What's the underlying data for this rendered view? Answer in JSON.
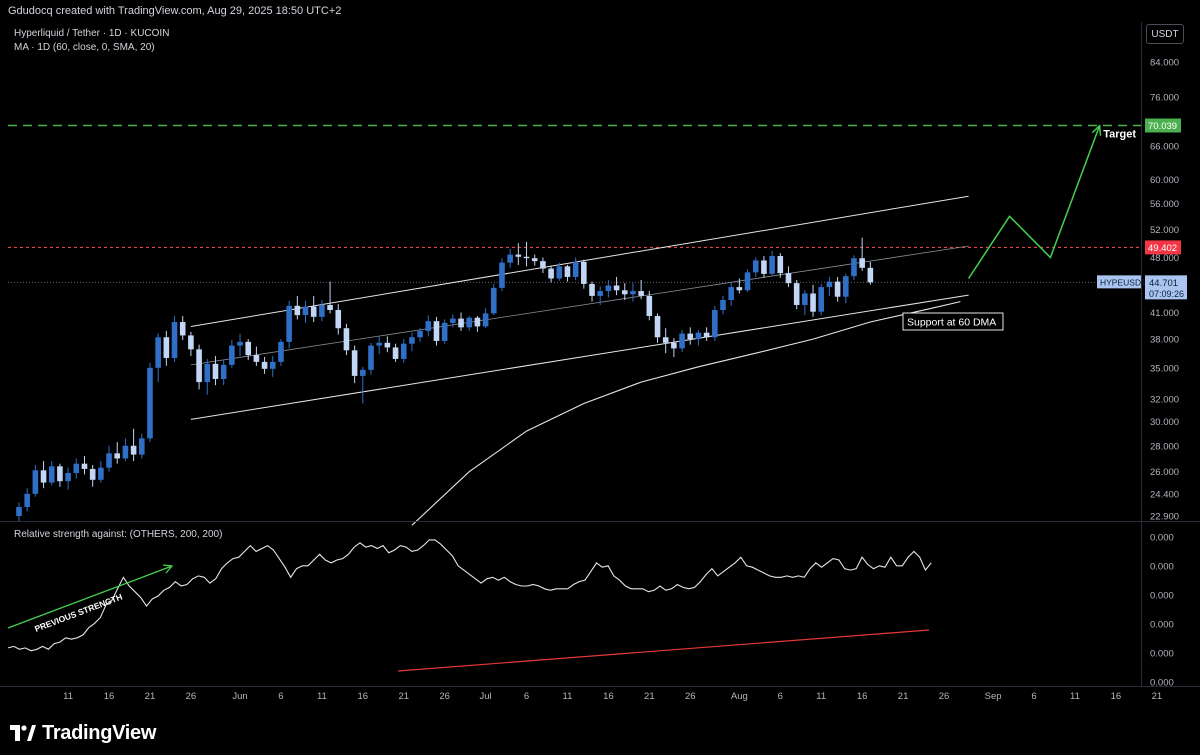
{
  "header": {
    "caption": "Gdudocq created with TradingView.com, Aug 29, 2025 18:50 UTC+2"
  },
  "legend": {
    "symbol": "Hyperliquid / Tether · 1D · KUCOIN",
    "ma": "MA · 1D (60, close, 0, SMA, 20)",
    "rs": "Relative strength against: (OTHERS, 200, 200)"
  },
  "currency_button": "USDT",
  "brand": {
    "name": "TradingView"
  },
  "colors": {
    "background": "#000000",
    "candle_up": "#2f6fc6",
    "candle_down": "#c3d6f5",
    "target_line": "#4caf50",
    "resistance_line": "#ff4d4d",
    "price_tag": "#a9c5f0",
    "rs_line": "#e6e6e6",
    "rs_trend": "#e53935",
    "arrow": "#43d14f"
  },
  "chart_data": [
    {
      "type": "candlestick",
      "title": "Hyperliquid / Tether · 1D · KUCOIN",
      "y_scale": "log",
      "ylim": [
        22.3,
        89
      ],
      "y_ticks": [
        "84.000",
        "76.000",
        "66.000",
        "60.000",
        "56.000",
        "52.000",
        "48.000",
        "44.000",
        "41.000",
        "38.000",
        "35.000",
        "32.000",
        "30.000",
        "28.000",
        "26.000",
        "24.400",
        "22.900"
      ],
      "x_ticks": [
        "11",
        "16",
        "21",
        "26",
        "Jun",
        "6",
        "11",
        "16",
        "21",
        "26",
        "Jul",
        "6",
        "11",
        "16",
        "21",
        "26",
        "Aug",
        "6",
        "11",
        "16",
        "21",
        "26",
        "Sep",
        "6",
        "11",
        "16",
        "21"
      ],
      "start_date": "2025-05-05",
      "ohlc": [
        [
          22.9,
          23.8,
          22.5,
          23.5
        ],
        [
          23.5,
          24.8,
          23.2,
          24.4
        ],
        [
          24.4,
          26.5,
          24.2,
          26.1
        ],
        [
          26.1,
          26.8,
          24.8,
          25.2
        ],
        [
          25.2,
          26.8,
          25.0,
          26.4
        ],
        [
          26.4,
          26.6,
          24.9,
          25.3
        ],
        [
          25.3,
          26.3,
          24.7,
          25.9
        ],
        [
          25.9,
          27.0,
          25.5,
          26.6
        ],
        [
          26.6,
          27.2,
          25.8,
          26.2
        ],
        [
          26.2,
          26.5,
          24.9,
          25.4
        ],
        [
          25.4,
          26.8,
          25.2,
          26.3
        ],
        [
          26.3,
          28.0,
          26.0,
          27.4
        ],
        [
          27.4,
          28.3,
          26.6,
          27.0
        ],
        [
          27.0,
          28.6,
          26.8,
          28.0
        ],
        [
          28.0,
          29.4,
          26.8,
          27.3
        ],
        [
          27.3,
          29.0,
          27.0,
          28.6
        ],
        [
          28.6,
          35.5,
          28.3,
          35.0
        ],
        [
          35.0,
          38.6,
          33.6,
          38.2
        ],
        [
          38.2,
          38.9,
          35.2,
          36.0
        ],
        [
          36.0,
          40.6,
          35.6,
          39.9
        ],
        [
          39.9,
          40.6,
          37.9,
          38.4
        ],
        [
          38.4,
          38.8,
          36.2,
          36.9
        ],
        [
          36.9,
          37.4,
          32.9,
          33.6
        ],
        [
          33.6,
          35.9,
          32.4,
          35.4
        ],
        [
          35.4,
          36.2,
          33.3,
          33.9
        ],
        [
          33.9,
          35.8,
          33.3,
          35.3
        ],
        [
          35.3,
          37.9,
          35.0,
          37.3
        ],
        [
          37.3,
          38.6,
          36.2,
          37.7
        ],
        [
          37.7,
          38.0,
          35.8,
          36.3
        ],
        [
          36.3,
          37.2,
          35.2,
          35.6
        ],
        [
          35.6,
          36.1,
          34.4,
          34.9
        ],
        [
          34.9,
          36.2,
          34.1,
          35.6
        ],
        [
          35.6,
          38.0,
          35.2,
          37.7
        ],
        [
          37.7,
          42.4,
          37.0,
          41.8
        ],
        [
          41.8,
          43.0,
          40.2,
          40.7
        ],
        [
          40.7,
          42.4,
          39.8,
          41.7
        ],
        [
          41.7,
          43.0,
          39.9,
          40.5
        ],
        [
          40.5,
          42.5,
          40.0,
          41.9
        ],
        [
          41.9,
          44.8,
          40.9,
          41.3
        ],
        [
          41.3,
          42.0,
          38.5,
          39.2
        ],
        [
          39.2,
          39.7,
          36.3,
          36.8
        ],
        [
          36.8,
          37.3,
          33.5,
          34.2
        ],
        [
          34.2,
          35.1,
          31.6,
          34.8
        ],
        [
          34.8,
          37.6,
          34.3,
          37.3
        ],
        [
          37.3,
          38.3,
          36.4,
          37.6
        ],
        [
          37.6,
          38.3,
          36.6,
          37.1
        ],
        [
          37.1,
          37.5,
          35.6,
          35.9
        ],
        [
          35.9,
          38.0,
          35.5,
          37.5
        ],
        [
          37.5,
          38.7,
          36.7,
          38.2
        ],
        [
          38.2,
          39.2,
          37.7,
          38.9
        ],
        [
          38.9,
          40.7,
          38.3,
          40.0
        ],
        [
          40.0,
          40.5,
          37.3,
          37.8
        ],
        [
          37.8,
          40.2,
          37.5,
          39.8
        ],
        [
          39.8,
          40.8,
          39.3,
          40.3
        ],
        [
          40.3,
          41.0,
          38.9,
          39.3
        ],
        [
          39.3,
          40.6,
          38.9,
          40.4
        ],
        [
          40.4,
          40.6,
          38.8,
          39.4
        ],
        [
          39.4,
          41.5,
          39.2,
          40.9
        ],
        [
          40.9,
          44.5,
          40.7,
          44.0
        ],
        [
          44.0,
          47.9,
          43.6,
          47.3
        ],
        [
          47.3,
          49.2,
          46.6,
          48.4
        ],
        [
          48.4,
          50.0,
          47.0,
          48.1
        ],
        [
          48.1,
          50.2,
          46.8,
          47.9
        ],
        [
          47.9,
          48.4,
          46.9,
          47.5
        ],
        [
          47.5,
          48.0,
          45.9,
          46.5
        ],
        [
          46.5,
          46.9,
          44.7,
          45.2
        ],
        [
          45.2,
          47.3,
          44.9,
          46.8
        ],
        [
          46.8,
          47.0,
          44.8,
          45.4
        ],
        [
          45.4,
          48.0,
          45.0,
          47.4
        ],
        [
          47.4,
          47.7,
          43.9,
          44.5
        ],
        [
          44.5,
          44.8,
          42.3,
          43.0
        ],
        [
          43.0,
          44.2,
          41.9,
          43.6
        ],
        [
          43.6,
          45.0,
          42.8,
          44.3
        ],
        [
          44.3,
          45.4,
          43.1,
          43.7
        ],
        [
          43.7,
          44.6,
          42.5,
          43.2
        ],
        [
          43.2,
          44.6,
          42.3,
          43.6
        ],
        [
          43.6,
          45.0,
          42.6,
          43.0
        ],
        [
          43.0,
          43.6,
          40.1,
          40.6
        ],
        [
          40.6,
          40.9,
          37.6,
          38.2
        ],
        [
          38.2,
          39.2,
          36.5,
          37.6
        ],
        [
          37.6,
          38.1,
          36.1,
          37.0
        ],
        [
          37.0,
          39.0,
          36.6,
          38.6
        ],
        [
          38.6,
          39.3,
          37.4,
          38.0
        ],
        [
          38.0,
          39.0,
          37.3,
          38.7
        ],
        [
          38.7,
          39.3,
          37.8,
          38.2
        ],
        [
          38.2,
          41.8,
          37.8,
          41.3
        ],
        [
          41.3,
          43.0,
          40.8,
          42.5
        ],
        [
          42.5,
          44.6,
          41.8,
          44.1
        ],
        [
          44.1,
          45.2,
          43.3,
          43.7
        ],
        [
          43.7,
          46.4,
          43.5,
          46.0
        ],
        [
          46.0,
          48.0,
          45.4,
          47.6
        ],
        [
          47.6,
          48.2,
          45.3,
          45.8
        ],
        [
          45.8,
          48.9,
          45.5,
          48.2
        ],
        [
          48.2,
          48.6,
          45.3,
          45.9
        ],
        [
          45.9,
          46.8,
          44.1,
          44.6
        ],
        [
          44.6,
          45.0,
          41.4,
          41.9
        ],
        [
          41.9,
          43.7,
          40.7,
          43.3
        ],
        [
          43.3,
          44.4,
          40.5,
          41.1
        ],
        [
          41.1,
          44.5,
          40.7,
          44.1
        ],
        [
          44.1,
          45.4,
          43.0,
          44.8
        ],
        [
          44.8,
          45.4,
          42.3,
          42.9
        ],
        [
          42.9,
          45.8,
          42.1,
          45.5
        ],
        [
          45.5,
          48.3,
          45.0,
          47.9
        ],
        [
          47.9,
          50.8,
          46.2,
          46.6
        ],
        [
          46.6,
          47.4,
          44.4,
          44.7
        ]
      ],
      "ma_60": [
        {
          "date": "2025-06-22",
          "value": 22.3
        },
        {
          "date": "2025-06-29",
          "value": 26.0
        },
        {
          "date": "2025-07-06",
          "value": 29.2
        },
        {
          "date": "2025-07-13",
          "value": 31.6
        },
        {
          "date": "2025-07-20",
          "value": 33.6
        },
        {
          "date": "2025-07-27",
          "value": 35.1
        },
        {
          "date": "2025-08-03",
          "value": 36.5
        },
        {
          "date": "2025-08-10",
          "value": 38.0
        },
        {
          "date": "2025-08-17",
          "value": 39.9
        },
        {
          "date": "2025-08-24",
          "value": 41.4
        },
        {
          "date": "2025-08-28",
          "value": 42.3
        }
      ],
      "channel_lines": [
        {
          "from": [
            "2025-05-26",
            39.4
          ],
          "to": [
            "2025-08-29",
            57.2
          ]
        },
        {
          "from": [
            "2025-05-26",
            30.2
          ],
          "to": [
            "2025-08-29",
            43.1
          ]
        },
        {
          "from": [
            "2025-05-26",
            35.3
          ],
          "to": [
            "2025-08-29",
            49.6
          ]
        }
      ],
      "levels": [
        {
          "price": 70.039,
          "label": "70.039",
          "style": "target"
        },
        {
          "price": 49.402,
          "label": "49.402",
          "style": "resistance"
        },
        {
          "price": 44.701,
          "label": "44.701",
          "style": "last"
        }
      ],
      "projection_arrow": [
        {
          "date": "2025-08-29",
          "value": 45.2
        },
        {
          "date": "2025-09-03",
          "value": 54.0
        },
        {
          "date": "2025-09-08",
          "value": 48.0
        },
        {
          "date": "2025-09-14",
          "value": 70.0
        }
      ],
      "price_label": {
        "symbol": "HYPEUSDT",
        "price": "44.701",
        "countdown": "07:09:26"
      },
      "annotations": {
        "target": "Target",
        "support": "Support at 60 DMA"
      }
    },
    {
      "type": "line",
      "title": "Relative strength against: (OTHERS, 200, 200)",
      "ylim": [
        0,
        1
      ],
      "y_ticks": [
        "0.000",
        "0.000",
        "0.000",
        "0.000",
        "0.000",
        "0.000"
      ],
      "start_date": "2025-05-05",
      "values": [
        0.23,
        0.24,
        0.22,
        0.23,
        0.21,
        0.22,
        0.24,
        0.22,
        0.26,
        0.27,
        0.3,
        0.29,
        0.3,
        0.32,
        0.37,
        0.4,
        0.44,
        0.53,
        0.56,
        0.64,
        0.72,
        0.66,
        0.62,
        0.58,
        0.52,
        0.57,
        0.59,
        0.63,
        0.65,
        0.69,
        0.66,
        0.67,
        0.71,
        0.73,
        0.72,
        0.68,
        0.71,
        0.78,
        0.82,
        0.85,
        0.86,
        0.9,
        0.94,
        0.9,
        0.92,
        0.94,
        0.91,
        0.85,
        0.79,
        0.72,
        0.78,
        0.8,
        0.8,
        0.84,
        0.88,
        0.84,
        0.82,
        0.84,
        0.85,
        0.88,
        0.93,
        0.96,
        0.93,
        0.94,
        0.92,
        0.94,
        0.89,
        0.91,
        0.94,
        0.93,
        0.9,
        0.91,
        0.94,
        0.98,
        0.98,
        0.95,
        0.91,
        0.87,
        0.8,
        0.77,
        0.74,
        0.71,
        0.68,
        0.71,
        0.72,
        0.7,
        0.72,
        0.69,
        0.67,
        0.66,
        0.66,
        0.67,
        0.66,
        0.64,
        0.63,
        0.64,
        0.64,
        0.64,
        0.67,
        0.69,
        0.7,
        0.76,
        0.82,
        0.79,
        0.8,
        0.73,
        0.7,
        0.66,
        0.64,
        0.64,
        0.64,
        0.62,
        0.63,
        0.66,
        0.63,
        0.64,
        0.67,
        0.65,
        0.64,
        0.65,
        0.69,
        0.74,
        0.78,
        0.73,
        0.76,
        0.79,
        0.82,
        0.86,
        0.8,
        0.79,
        0.77,
        0.75,
        0.73,
        0.72,
        0.72,
        0.73,
        0.72,
        0.73,
        0.72,
        0.78,
        0.82,
        0.79,
        0.82,
        0.85,
        0.84,
        0.78,
        0.77,
        0.78,
        0.86,
        0.81,
        0.78,
        0.8,
        0.79,
        0.86,
        0.8,
        0.8,
        0.86,
        0.9,
        0.86,
        0.77,
        0.82
      ]
    }
  ],
  "rs_annotations": {
    "previous_strength": "PREVIOUS STRENGTH"
  }
}
